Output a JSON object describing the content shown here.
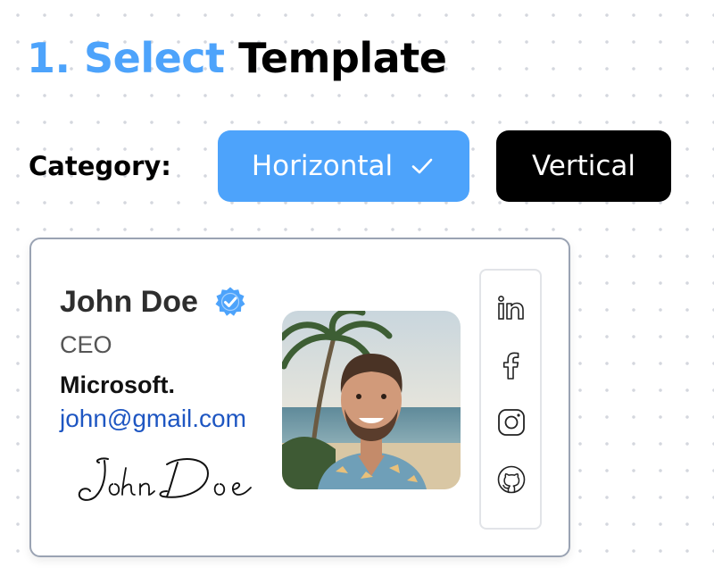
{
  "heading": {
    "number": "1.",
    "accent_word": "Select",
    "rest": "Template"
  },
  "category": {
    "label": "Category:",
    "options": [
      {
        "label": "Horizontal",
        "selected": true
      },
      {
        "label": "Vertical",
        "selected": false
      }
    ]
  },
  "card": {
    "name": "John Doe",
    "role": "CEO",
    "company": "Microsoft.",
    "email": "john@gmail.com",
    "signature_text": "John Doe",
    "social_icons": [
      "linkedin-icon",
      "facebook-icon",
      "instagram-icon",
      "github-icon"
    ]
  },
  "colors": {
    "accent": "#4da3fb",
    "selected_button": "#4da3fb",
    "unselected_button": "#000000",
    "email_link": "#1e56c2",
    "card_border": "#9aa3b3"
  }
}
